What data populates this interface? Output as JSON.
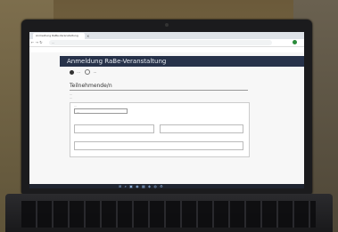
{
  "browser": {
    "tab_title": "Anmeldung RaBe-Veranstaltung",
    "tab_close": "×",
    "nav_icons": "← → ↻",
    "url": "...",
    "bookmarks_left": "",
    "bookmarks_right": ""
  },
  "page": {
    "header_title": "Anmeldung RaBe-Veranstaltung",
    "steps": [
      {
        "label": "..."
      },
      {
        "label": "..."
      }
    ],
    "section_title": "Teilnehmende/n",
    "intro_line_1": "...",
    "intro_line_2": "...",
    "form": {
      "select_label": "...",
      "select_value": "...",
      "field_1_label": "",
      "field_2_label": "",
      "field_3_label": ""
    }
  },
  "taskbar": {
    "icons": "⊞ ⌕ ▣ ◉ ▦ ◈ ◍ ⚙",
    "clock": ""
  },
  "colors": {
    "header_band": "#27324a",
    "page_bg": "#f7f7f7",
    "taskbar": "#1f2430"
  }
}
